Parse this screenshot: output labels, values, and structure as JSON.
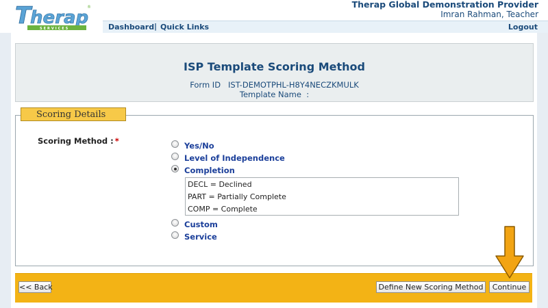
{
  "header": {
    "logo_text": "Therap",
    "logo_sub": "SERVICES",
    "provider": "Therap Global Demonstration Provider",
    "user": "Imran Rahman, Teacher",
    "nav": {
      "dashboard": "Dashboard",
      "separator": "|",
      "quick_links": "Quick Links",
      "logout": "Logout"
    }
  },
  "title_box": {
    "title": "ISP Template Scoring Method",
    "form_id": "Form ID   IST-DEMOTPHL-H8Y4NECZKMULK",
    "template_name": "Template Name  :"
  },
  "details": {
    "tab_label": "Scoring Details",
    "method_label": "Scoring Method :",
    "required_mark": "*",
    "options": [
      {
        "label": "Yes/No",
        "checked": false
      },
      {
        "label": "Level of Independence",
        "checked": false
      },
      {
        "label": "Completion",
        "checked": true
      },
      {
        "label": "Custom",
        "checked": false
      },
      {
        "label": "Service",
        "checked": false
      }
    ],
    "codes": [
      "DECL = Declined",
      "PART = Partially Complete",
      "COMP = Complete"
    ]
  },
  "bottom": {
    "back": "<< Back",
    "define": "Define New Scoring Method",
    "continue": "Continue"
  },
  "colors": {
    "brand_blue": "#1a4a7a",
    "bar_gold": "#f3b315",
    "tab_gold": "#f7c948",
    "arrow_orange": "#f2a413",
    "link_blue": "#1b3f9a"
  },
  "icons": {
    "arrow": "arrow-down-icon",
    "radio": "radio-button-icon"
  }
}
